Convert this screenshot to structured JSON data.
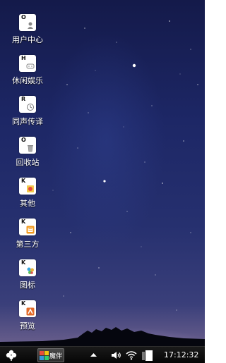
{
  "desktop": {
    "icons": [
      {
        "letter": "O",
        "label": "用户中心",
        "icon": "user-icon"
      },
      {
        "letter": "H",
        "label": "休闲娱乐",
        "icon": "gamepad-icon"
      },
      {
        "letter": "R",
        "label": "同声传译",
        "icon": "clock-icon"
      },
      {
        "letter": "O",
        "label": "回收站",
        "icon": "trash-icon"
      },
      {
        "letter": "K",
        "label": "其他",
        "icon": "misc-icon"
      },
      {
        "letter": "K",
        "label": "第三方",
        "icon": "thirdparty-icon"
      },
      {
        "letter": "K",
        "label": "图标",
        "icon": "palette-icon"
      },
      {
        "letter": "K",
        "label": "预览",
        "icon": "preview-icon"
      }
    ]
  },
  "taskbar": {
    "start_icon": "clover-icon",
    "task_label": "魔伴",
    "clock": "17:12:32"
  }
}
